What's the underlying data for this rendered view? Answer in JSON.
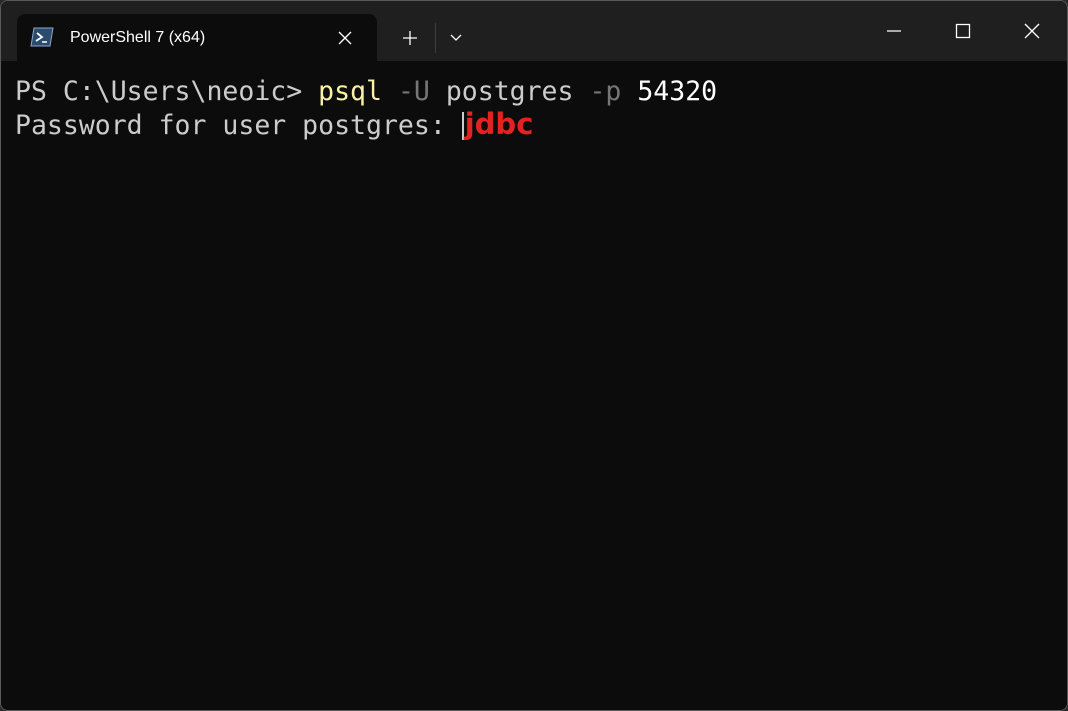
{
  "window": {
    "tab_title": "PowerShell 7 (x64)",
    "icons": {
      "tab": "powershell-icon",
      "tab_close": "close-icon",
      "new_tab": "plus-icon",
      "dropdown": "chevron-down-icon",
      "minimize": "minimize-icon",
      "maximize": "maximize-icon",
      "close": "close-icon"
    }
  },
  "terminal": {
    "line1": {
      "prompt": "PS C:\\Users\\neoic> ",
      "command": "psql",
      "flag_user": "-U",
      "user": "postgres",
      "flag_port": "-p",
      "port": "54320"
    },
    "line2": {
      "text": "Password for user postgres: ",
      "typed": "jdbc"
    }
  },
  "colors": {
    "background": "#0c0c0c",
    "titlebar": "#1f1f1f",
    "command": "#f9f1a5",
    "parameter": "#767676",
    "typed_text": "#e52222"
  }
}
